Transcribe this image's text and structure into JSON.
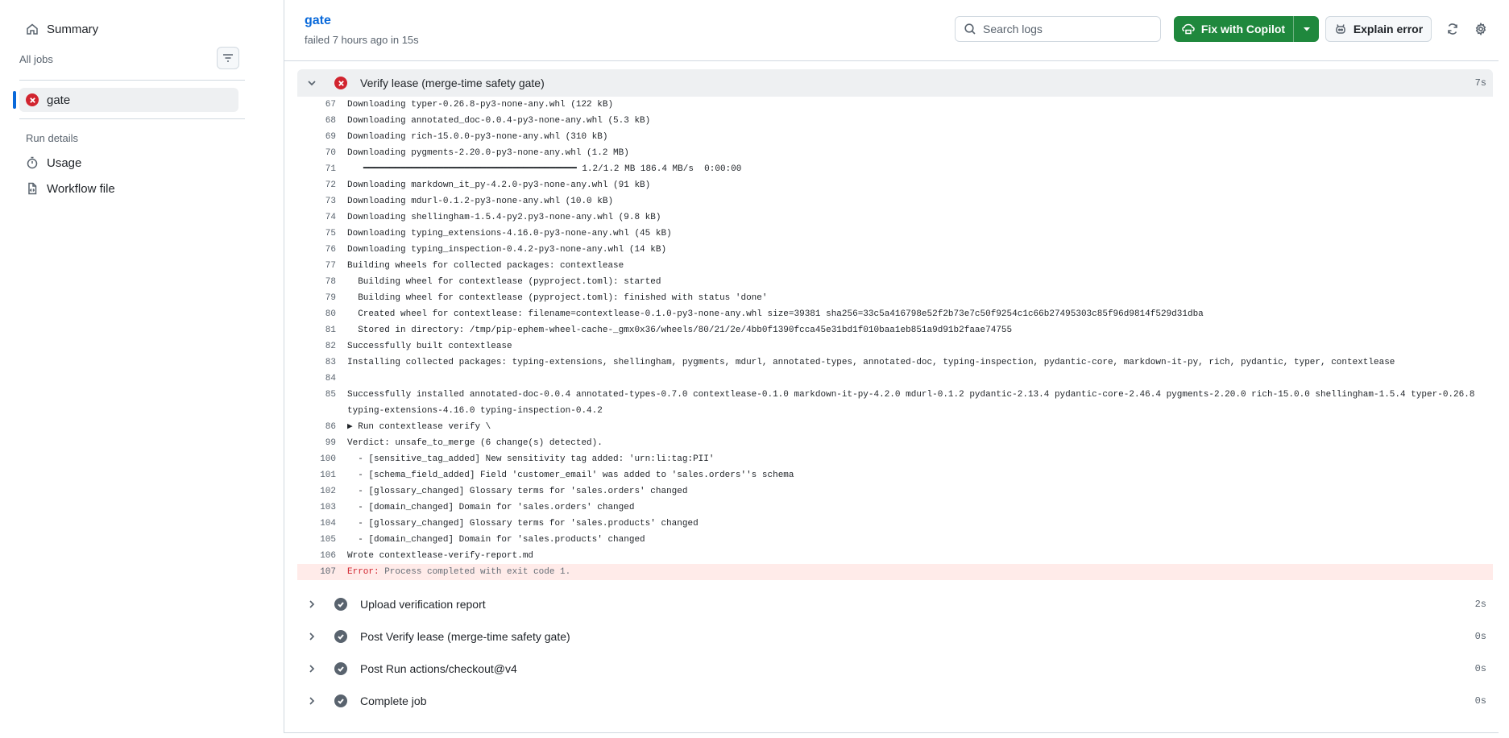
{
  "sidebar": {
    "summary_label": "Summary",
    "all_jobs_label": "All jobs",
    "job": {
      "label": "gate",
      "status": "failed"
    },
    "run_details_label": "Run details",
    "usage_label": "Usage",
    "workflow_file_label": "Workflow file"
  },
  "header": {
    "title": "gate",
    "subtitle": "failed 7 hours ago in 15s",
    "search_placeholder": "Search logs",
    "fix_label": "Fix with Copilot",
    "explain_label": "Explain error"
  },
  "open_step": {
    "name": "Verify lease (merge-time safety gate)",
    "duration": "7s"
  },
  "log_lines": [
    {
      "n": "67",
      "t": "Downloading typer-0.26.8-py3-none-any.whl (122 kB)"
    },
    {
      "n": "68",
      "t": "Downloading annotated_doc-0.0.4-py3-none-any.whl (5.3 kB)"
    },
    {
      "n": "69",
      "t": "Downloading rich-15.0.0-py3-none-any.whl (310 kB)"
    },
    {
      "n": "70",
      "t": "Downloading pygments-2.20.0-py3-none-any.whl (1.2 MB)"
    },
    {
      "n": "71",
      "t": "   ━━━━━━━━━━━━━━━━━━━━━━━━━━━━━━━━━━━━━━━━ 1.2/1.2 MB 186.4 MB/s  0:00:00"
    },
    {
      "n": "72",
      "t": "Downloading markdown_it_py-4.2.0-py3-none-any.whl (91 kB)"
    },
    {
      "n": "73",
      "t": "Downloading mdurl-0.1.2-py3-none-any.whl (10.0 kB)"
    },
    {
      "n": "74",
      "t": "Downloading shellingham-1.5.4-py2.py3-none-any.whl (9.8 kB)"
    },
    {
      "n": "75",
      "t": "Downloading typing_extensions-4.16.0-py3-none-any.whl (45 kB)"
    },
    {
      "n": "76",
      "t": "Downloading typing_inspection-0.4.2-py3-none-any.whl (14 kB)"
    },
    {
      "n": "77",
      "t": "Building wheels for collected packages: contextlease"
    },
    {
      "n": "78",
      "t": "  Building wheel for contextlease (pyproject.toml): started"
    },
    {
      "n": "79",
      "t": "  Building wheel for contextlease (pyproject.toml): finished with status 'done'"
    },
    {
      "n": "80",
      "t": "  Created wheel for contextlease: filename=contextlease-0.1.0-py3-none-any.whl size=39381 sha256=33c5a416798e52f2b73e7c50f9254c1c66b27495303c85f96d9814f529d31dba"
    },
    {
      "n": "81",
      "t": "  Stored in directory: /tmp/pip-ephem-wheel-cache-_gmx0x36/wheels/80/21/2e/4bb0f1390fcca45e31bd1f010baa1eb851a9d91b2faae74755"
    },
    {
      "n": "82",
      "t": "Successfully built contextlease"
    },
    {
      "n": "83",
      "t": "Installing collected packages: typing-extensions, shellingham, pygments, mdurl, annotated-types, annotated-doc, typing-inspection, pydantic-core, markdown-it-py, rich, pydantic, typer, contextlease"
    },
    {
      "n": "84",
      "t": ""
    },
    {
      "n": "85",
      "t": "Successfully installed annotated-doc-0.0.4 annotated-types-0.7.0 contextlease-0.1.0 markdown-it-py-4.2.0 mdurl-0.1.2 pydantic-2.13.4 pydantic-core-2.46.4 pygments-2.20.0 rich-15.0.0 shellingham-1.5.4 typer-0.26.8 typing-extensions-4.16.0 typing-inspection-0.4.2",
      "wrap": true
    },
    {
      "n": "86",
      "t": "▶ Run contextlease verify \\"
    },
    {
      "n": "99",
      "t": "Verdict: unsafe_to_merge (6 change(s) detected)."
    },
    {
      "n": "100",
      "t": "  - [sensitive_tag_added] New sensitivity tag added: 'urn:li:tag:PII'"
    },
    {
      "n": "101",
      "t": "  - [schema_field_added] Field 'customer_email' was added to 'sales.orders''s schema"
    },
    {
      "n": "102",
      "t": "  - [glossary_changed] Glossary terms for 'sales.orders' changed"
    },
    {
      "n": "103",
      "t": "  - [domain_changed] Domain for 'sales.orders' changed"
    },
    {
      "n": "104",
      "t": "  - [glossary_changed] Glossary terms for 'sales.products' changed"
    },
    {
      "n": "105",
      "t": "  - [domain_changed] Domain for 'sales.products' changed"
    },
    {
      "n": "106",
      "t": "Wrote contextlease-verify-report.md"
    }
  ],
  "error_line": {
    "n": "107",
    "label": "Error:",
    "msg": " Process completed with exit code 1."
  },
  "steps": [
    {
      "name": "Upload verification report",
      "duration": "2s"
    },
    {
      "name": "Post Verify lease (merge-time safety gate)",
      "duration": "0s"
    },
    {
      "name": "Post Run actions/checkout@v4",
      "duration": "0s"
    },
    {
      "name": "Complete job",
      "duration": "0s"
    }
  ],
  "colors": {
    "accent": "#0969da",
    "success": "#1f883d",
    "danger": "#d1242f",
    "muted": "#59636e"
  }
}
